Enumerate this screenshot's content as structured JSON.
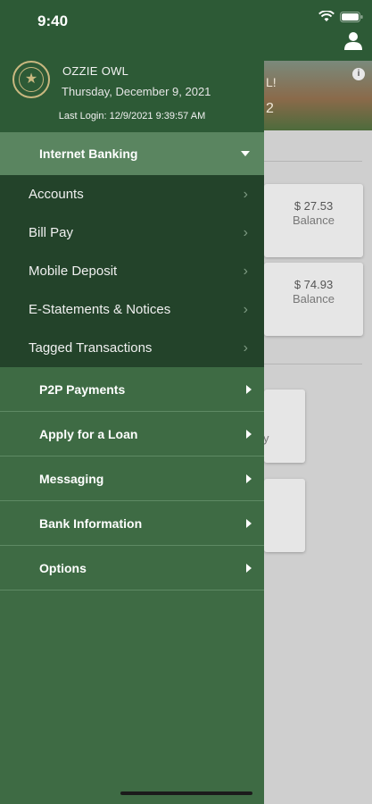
{
  "status_bar": {
    "time": "9:40"
  },
  "profile": {
    "name": "OZZIE OWL",
    "date": "Thursday, December 9, 2021",
    "last_login": "Last Login: 12/9/2021 9:39:57 AM"
  },
  "section": {
    "label": "Internet Banking"
  },
  "submenu": [
    {
      "label": "Accounts"
    },
    {
      "label": "Bill Pay"
    },
    {
      "label": "Mobile Deposit"
    },
    {
      "label": "E-Statements & Notices"
    },
    {
      "label": "Tagged Transactions"
    }
  ],
  "menu": [
    {
      "label": "P2P Payments"
    },
    {
      "label": "Apply for a Loan"
    },
    {
      "label": "Messaging"
    },
    {
      "label": "Bank Information"
    },
    {
      "label": "Options"
    }
  ],
  "background": {
    "hero_text_1": "L!",
    "hero_text_2": "2",
    "cards": [
      {
        "amount": "$ 27.53",
        "label": "Balance"
      },
      {
        "amount": "$ 74.93",
        "label": "Balance"
      }
    ],
    "card3_fragment": "y"
  },
  "colors": {
    "drawer": "#3e6b44",
    "header": "#2d5a36",
    "section_header": "#5a8560",
    "submenu": "#23432a",
    "background": "#cfcfcf"
  }
}
